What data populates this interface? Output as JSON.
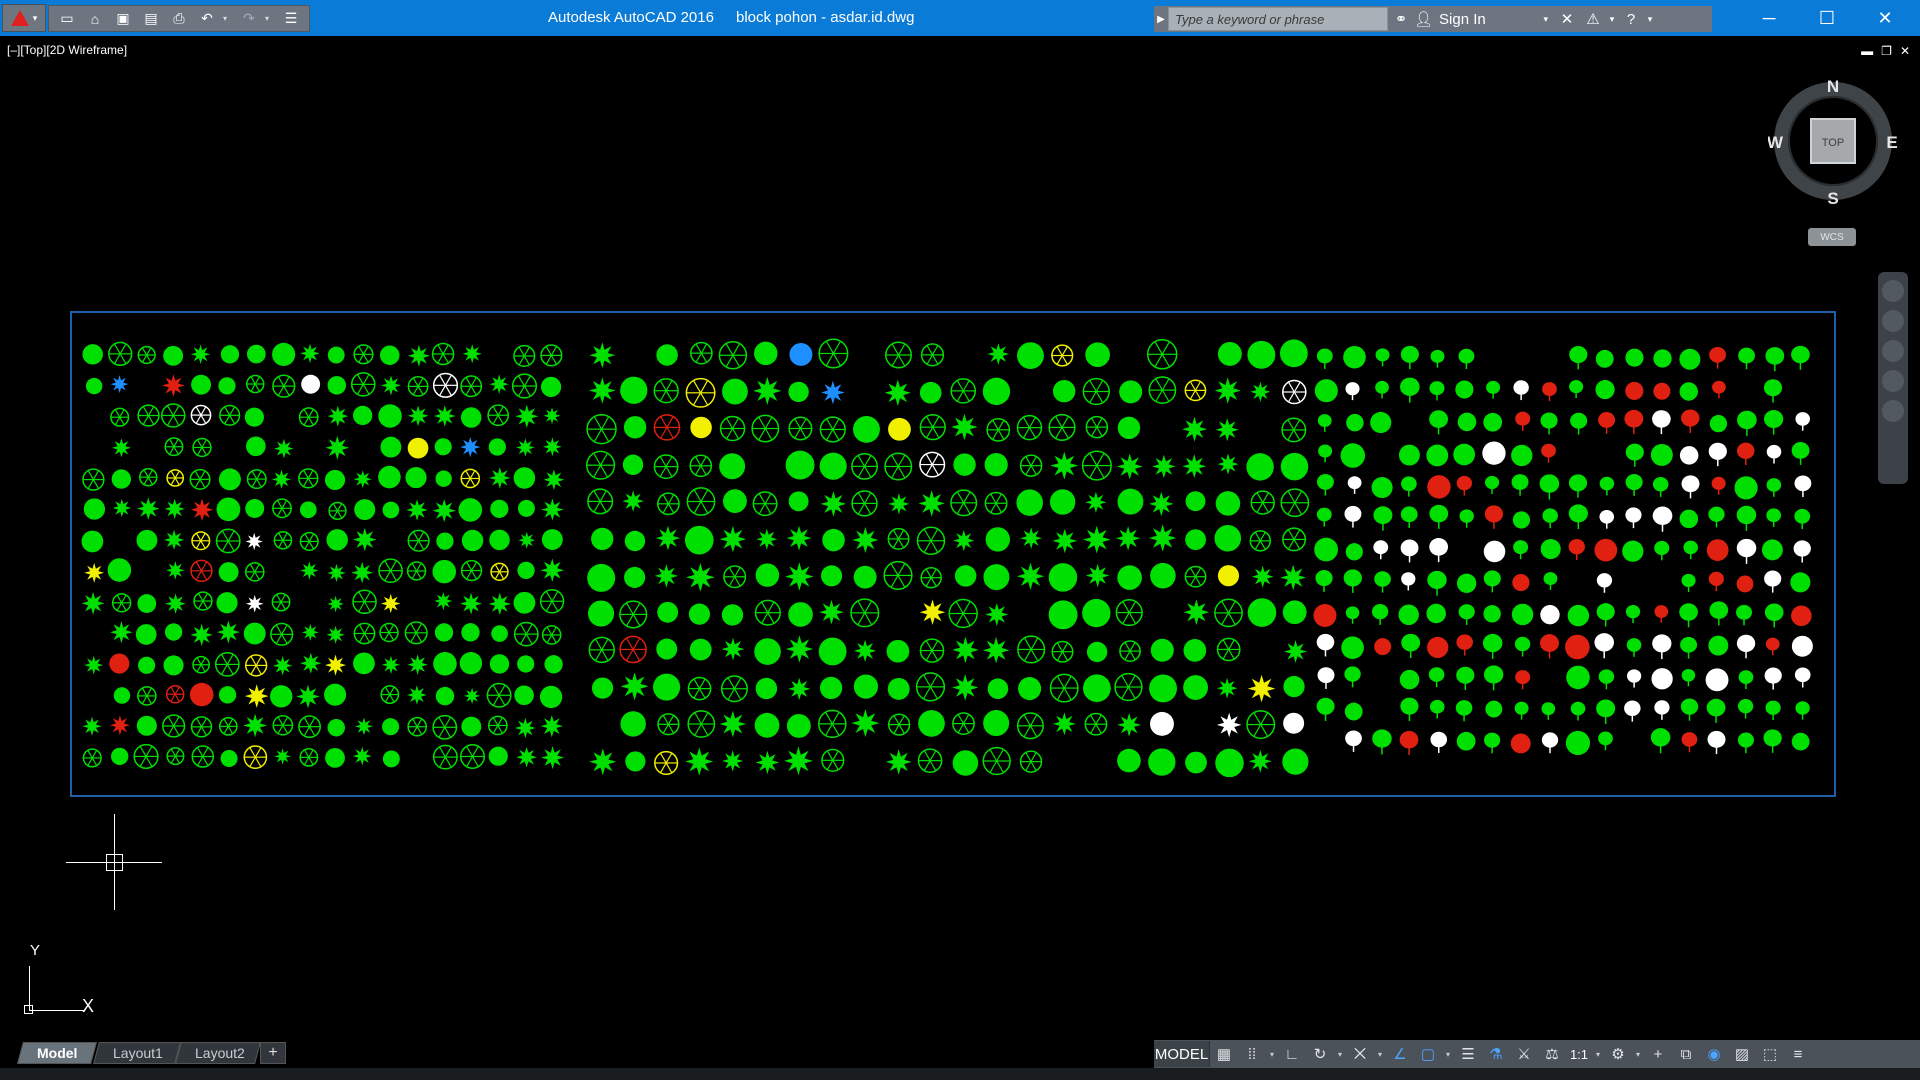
{
  "titlebar": {
    "app_name": "Autodesk AutoCAD 2016",
    "file_name": "block pohon - asdar.id.dwg",
    "search_placeholder": "Type a keyword or phrase",
    "sign_in": "Sign In"
  },
  "viewport": {
    "label": "[–][Top][2D Wireframe]"
  },
  "viewcube": {
    "face": "TOP",
    "north": "N",
    "south": "S",
    "east": "E",
    "west": "W",
    "coord_system": "WCS"
  },
  "ucs": {
    "x_label": "X",
    "y_label": "Y"
  },
  "tabs": [
    {
      "label": "Model",
      "active": true
    },
    {
      "label": "Layout1",
      "active": false
    },
    {
      "label": "Layout2",
      "active": false
    }
  ],
  "add_tab": "+",
  "statusbar": {
    "model": "MODEL",
    "scale": "1:1"
  },
  "colors": {
    "titlebar": "#0a7bd6",
    "frame": "#1e5fa8",
    "symbol_green": "#00e000",
    "symbol_white": "#ffffff",
    "symbol_red": "#e02010",
    "symbol_yellow": "#f0f000",
    "symbol_blue": "#1e8fff"
  }
}
